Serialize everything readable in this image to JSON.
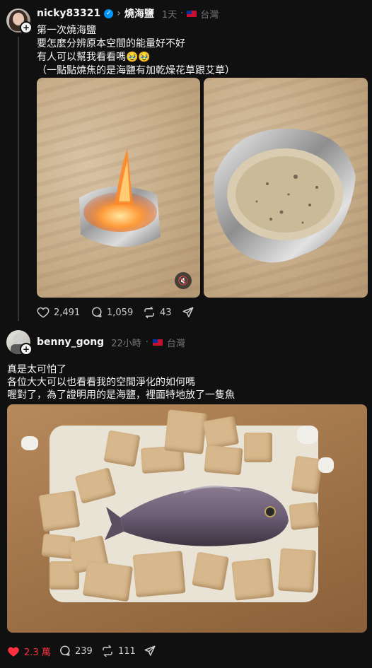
{
  "post1": {
    "username": "nicky83321",
    "breadcrumb": "燒海鹽",
    "time": "1天",
    "location": "台灣",
    "lines": [
      "第一次燒海鹽",
      "要怎麼分辨原本空間的能量好不好",
      "有人可以幫我看看嗎🥹🥹",
      "（一點點燒焦的是海鹽有加乾燥花草跟艾草）"
    ],
    "likes": "2,491",
    "comments": "1,059",
    "reposts": "43"
  },
  "post2": {
    "username": "benny_gong",
    "time": "22小時",
    "location": "台灣",
    "lines": [
      "真是太可怕了",
      "各位大大可以也看看我的空間淨化的如何嗎",
      "喔對了，為了證明用的是海鹽，裡面特地放了一隻魚"
    ],
    "likes": "2.3 萬",
    "comments": "239",
    "reposts": "111"
  },
  "icons": {
    "like": "heart-icon",
    "comment": "comment-icon",
    "repost": "repost-icon",
    "share": "share-icon",
    "verified": "verified-icon",
    "mute": "mute-icon",
    "follow": "plus-icon"
  },
  "colors": {
    "background": "#101010",
    "liked": "#ff3040",
    "verified": "#0095f6"
  }
}
